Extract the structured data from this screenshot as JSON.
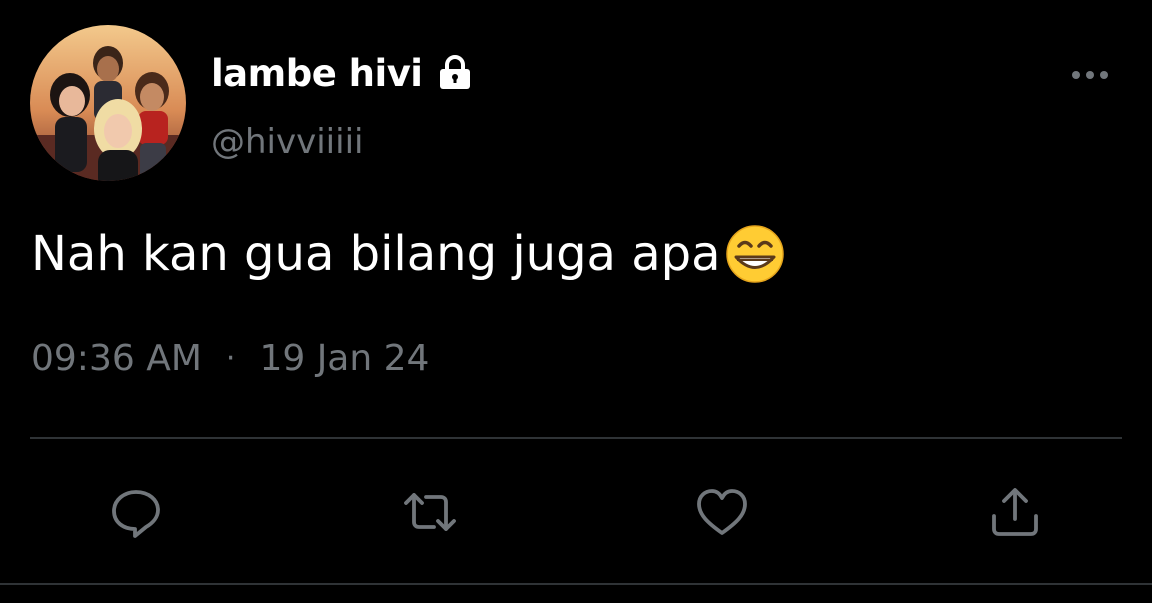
{
  "author": {
    "display_name": "lambe hivi",
    "handle": "@hivviiiii",
    "protected_icon": "lock-icon",
    "avatar": "avatar-illustration"
  },
  "tweet": {
    "text": "Nah kan gua bilang juga apa",
    "emoji": "grinning-face-with-smiling-eyes",
    "time": "09:36 AM",
    "separator": "·",
    "date": "19 Jan 24"
  },
  "actions": {
    "reply_icon": "comment-icon",
    "retweet_icon": "retweet-icon",
    "like_icon": "heart-icon",
    "share_icon": "share-icon",
    "more_icon": "more-icon"
  },
  "colors": {
    "background": "#000000",
    "primary_text": "#ffffff",
    "secondary_text": "#71767b",
    "divider": "#2f3336"
  }
}
